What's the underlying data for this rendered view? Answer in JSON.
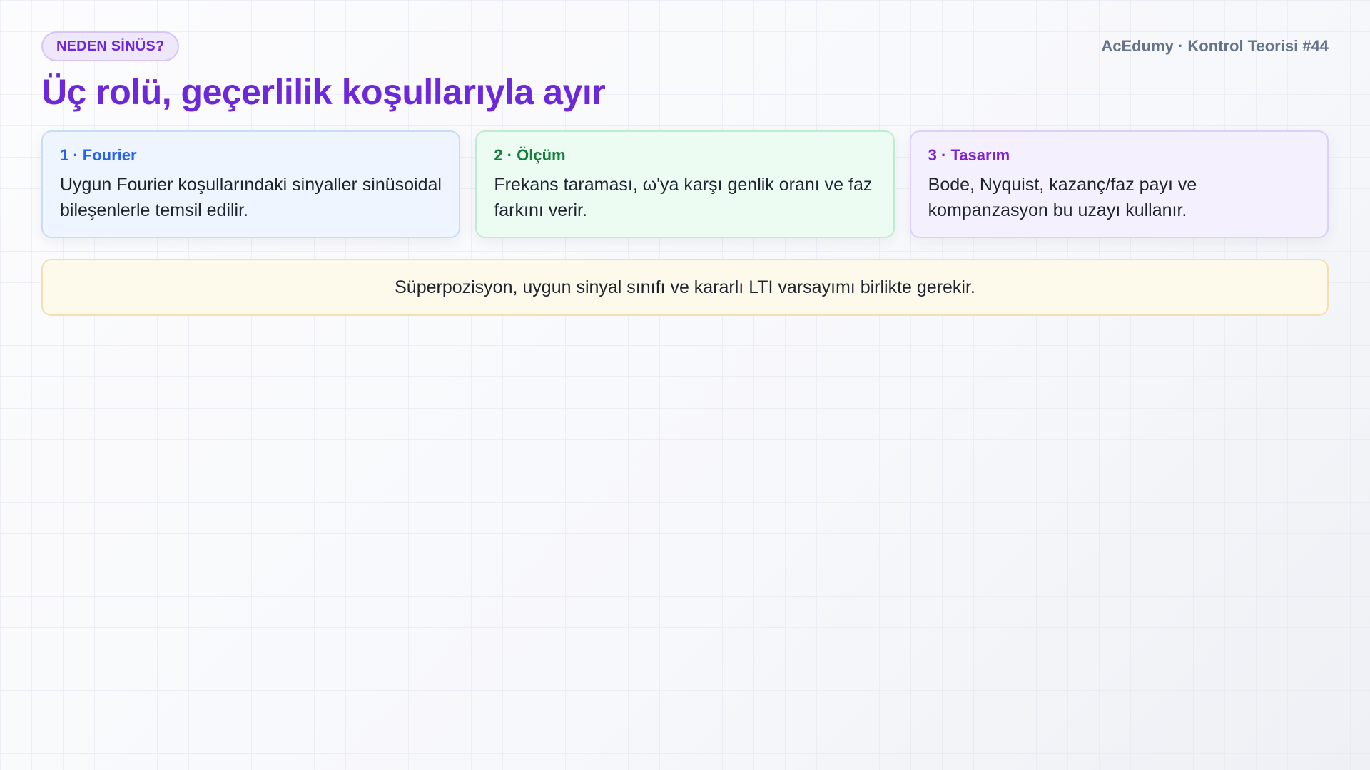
{
  "header": {
    "badge": "NEDEN SİNÜS?",
    "brand": "AcEdumy · Kontrol Teorisi #44",
    "title": "Üç rolü, geçerlilik koşullarıyla ayır"
  },
  "cards": [
    {
      "title": "1 · Fourier",
      "text": "Uygun Fourier koşullarındaki sinyaller sinüsoidal bileşenlerle temsil edilir.",
      "accent": "#2563eb"
    },
    {
      "title": "2 · Ölçüm",
      "text": "Frekans taraması, ω'ya karşı genlik oranı ve faz farkını verir.",
      "accent": "#15803d"
    },
    {
      "title": "3 · Tasarım",
      "text": "Bode, Nyquist, kazanç/faz payı ve kompanzasyon bu uzayı kullanır.",
      "accent": "#7e22ce"
    }
  ],
  "note": {
    "text": "Süperpozisyon, uygun sinyal sınıfı ve kararlı LTI varsayımı birlikte gerekir."
  },
  "colors": {
    "title": "#6d28d9",
    "note_background": "#fefaeb"
  }
}
